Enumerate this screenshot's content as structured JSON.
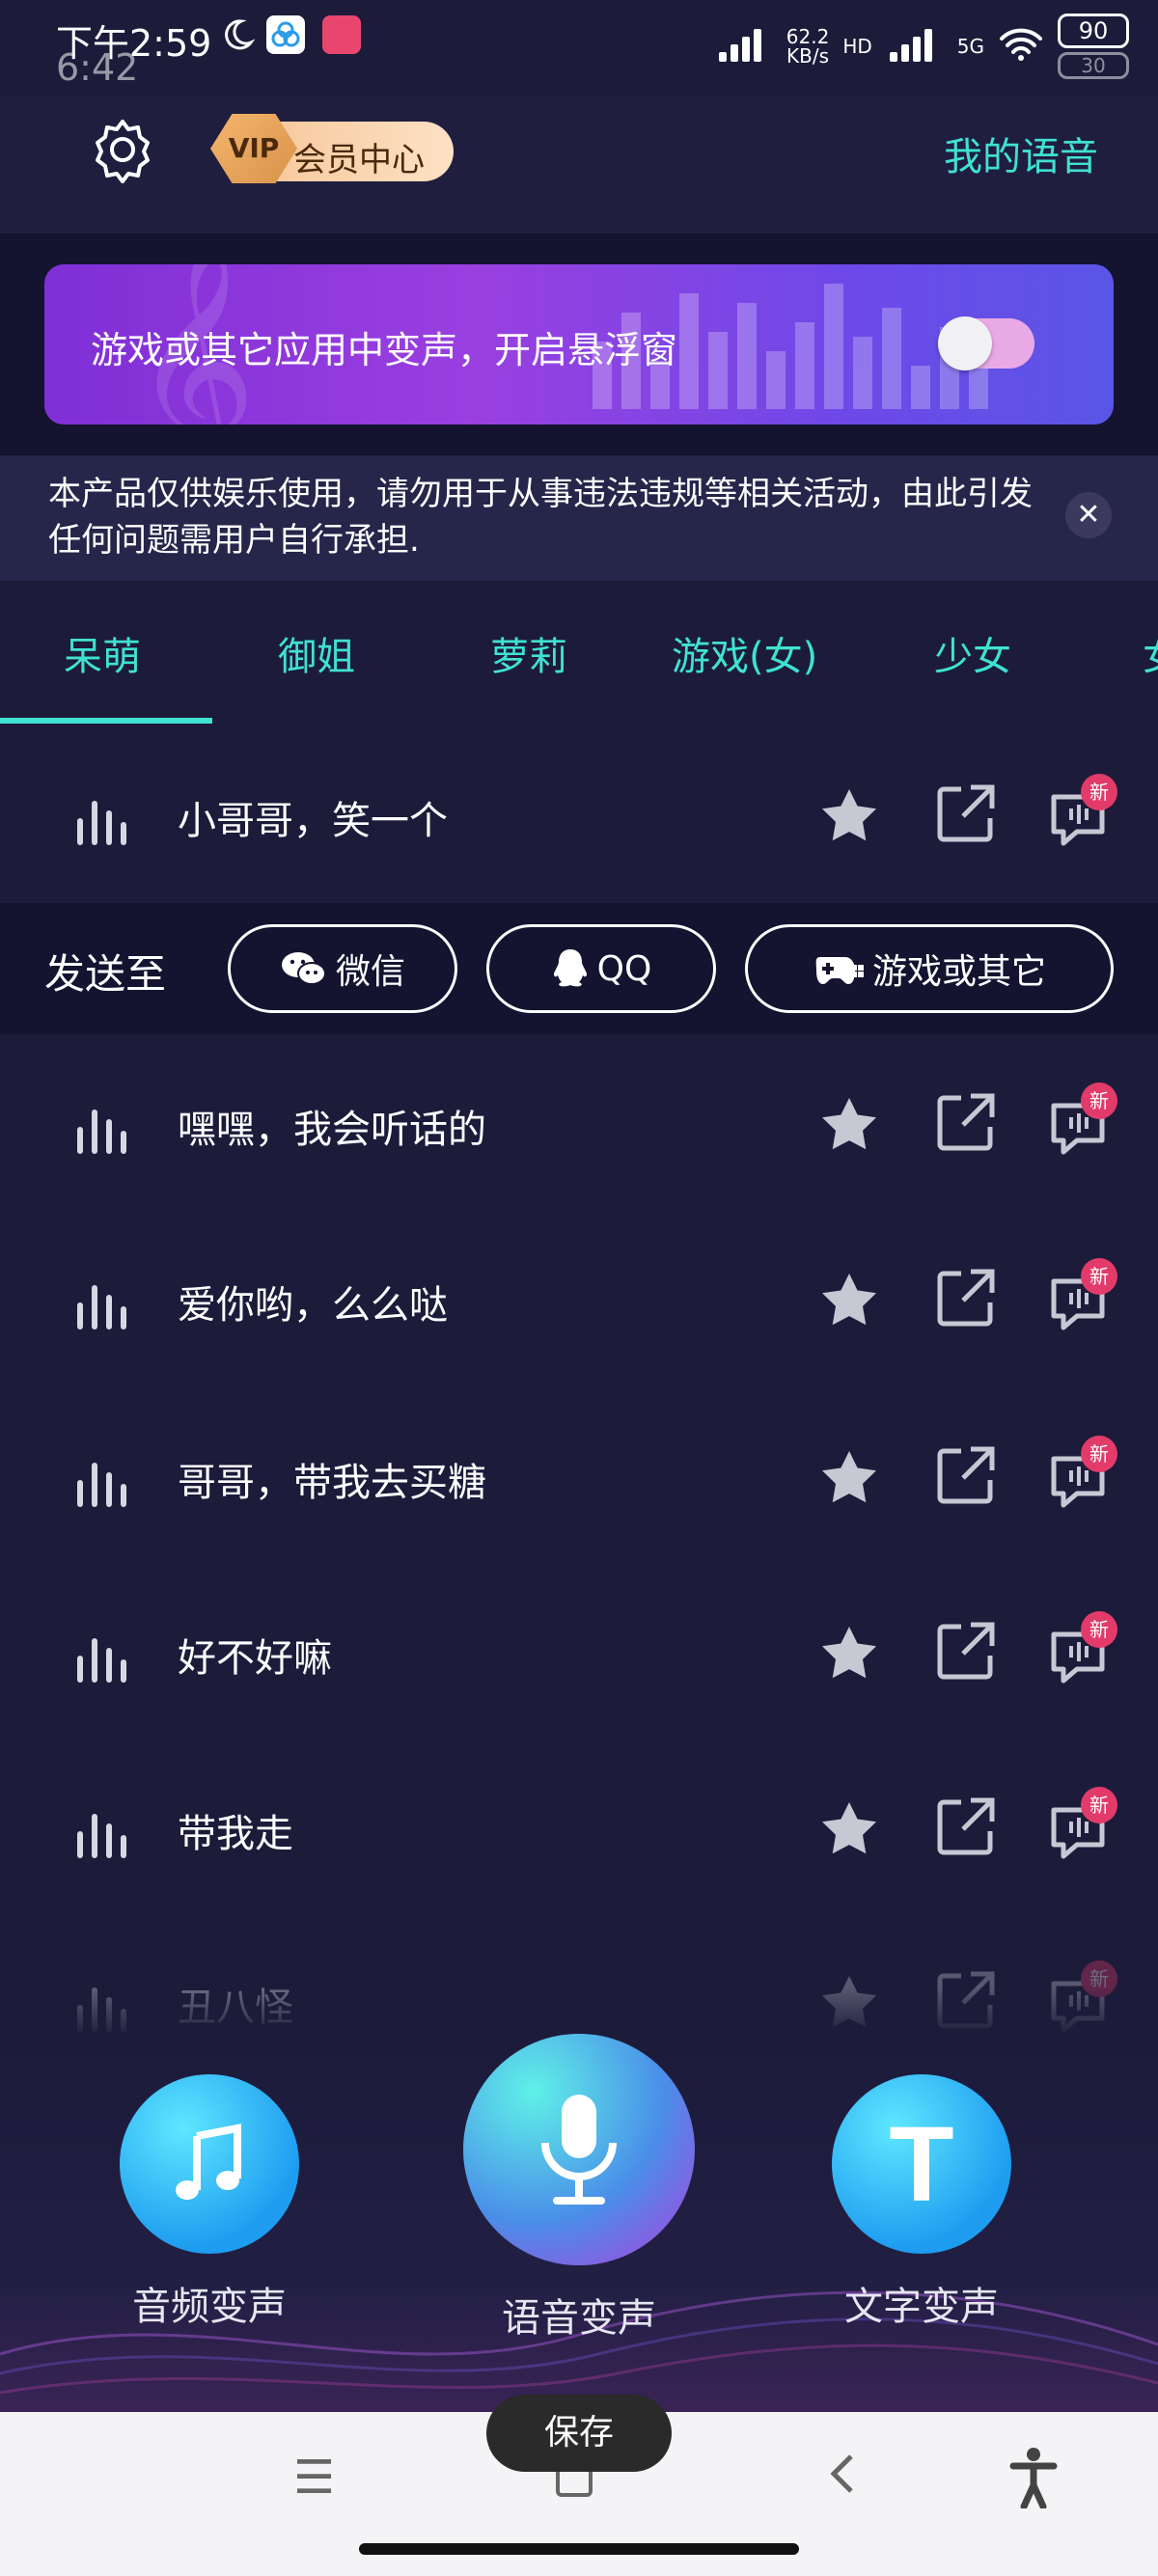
{
  "status_bar": {
    "time": "下午2:59",
    "time_secondary": "6:42",
    "network_speed_value": "62.2",
    "network_speed_unit": "KB/s",
    "hd": "HD",
    "signal": "5G",
    "battery": "90",
    "battery_secondary": "30"
  },
  "header": {
    "vip_badge": "VIP",
    "vip_label": "会员中心",
    "my_voice": "我的语音"
  },
  "banner": {
    "text": "游戏或其它应用中变声，开启悬浮窗",
    "toggle_on": false
  },
  "notice": {
    "text": "本产品仅供娱乐使用，请勿用于从事违法违规等相关活动，由此引发任何问题需用户自行承担."
  },
  "tabs": [
    {
      "label": "呆萌",
      "active": true
    },
    {
      "label": "御姐"
    },
    {
      "label": "萝莉"
    },
    {
      "label": "游戏(女)"
    },
    {
      "label": "少女"
    },
    {
      "label": "女"
    }
  ],
  "send_to": {
    "label": "发送至",
    "wechat": "微信",
    "qq": "QQ",
    "game": "游戏或其它"
  },
  "voices": [
    {
      "title": "小哥哥，笑一个",
      "badge": "新"
    },
    {
      "title": "嘿嘿，我会听话的",
      "badge": "新"
    },
    {
      "title": "爱你哟，么么哒",
      "badge": "新"
    },
    {
      "title": "哥哥，带我去买糖",
      "badge": "新"
    },
    {
      "title": "好不好嘛",
      "badge": "新"
    },
    {
      "title": "带我走",
      "badge": "新"
    },
    {
      "title": "丑八怪",
      "badge": "新"
    }
  ],
  "actions": {
    "audio": "音频变声",
    "voice": "语音变声",
    "text": "文字变声",
    "text_icon": "T"
  },
  "toast": "保存",
  "colors": {
    "accent": "#3fe2d1",
    "background": "#1c1b3a",
    "new_badge": "#e23b6a"
  }
}
